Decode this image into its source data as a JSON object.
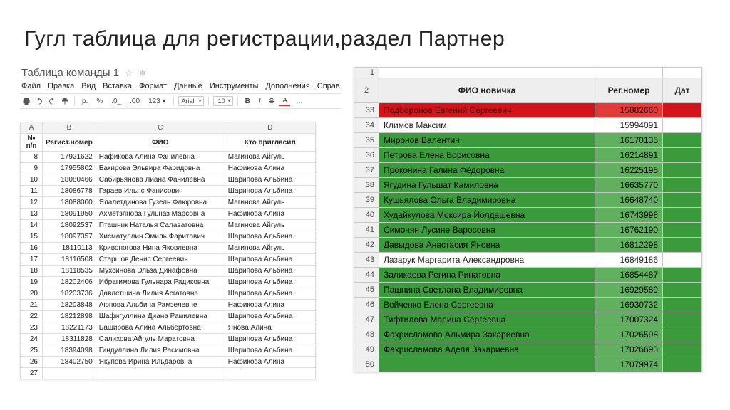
{
  "slide": {
    "title": "Гугл таблица для регистрации,раздел Партнер"
  },
  "left": {
    "sheet_name": "Таблица команды 1",
    "menu": [
      "Файл",
      "Правка",
      "Вид",
      "Вставка",
      "Формат",
      "Данные",
      "Инструменты",
      "Дополнения",
      "Справ"
    ],
    "toolbar": {
      "currency": "р.",
      "percent": "%",
      "dec0": ".0_",
      "dec00": ".00",
      "numfmt": "123 ▾",
      "font": "Arial",
      "size": "10"
    },
    "headers": [
      "№ п/п",
      "Регист.номер",
      "ФИО",
      "Кто пригласил"
    ],
    "rows": [
      {
        "n": 8,
        "reg": 17921622,
        "fio": "Нафикова Алина Фанилевна",
        "inv": "Магинова Айгуль"
      },
      {
        "n": 9,
        "reg": 17955802,
        "fio": "Бакирова Эльвира Фаридовна",
        "inv": "Нафикова Алина"
      },
      {
        "n": 10,
        "reg": 18080466,
        "fio": "Сабирьянова Лиана Фанилевна",
        "inv": "Шарипова Альбина"
      },
      {
        "n": 11,
        "reg": 18086778,
        "fio": "Гараев Ильяс Фанисович",
        "inv": "Шарипова Альбина"
      },
      {
        "n": 12,
        "reg": 18088000,
        "fio": "Ялалетдинова Гузель Флюровна",
        "inv": "Магинова Айгуль"
      },
      {
        "n": 13,
        "reg": 18091950,
        "fio": "Ахметзянова Гульназ Марсовна",
        "inv": "Нафикова Алина"
      },
      {
        "n": 14,
        "reg": 18092537,
        "fio": "Пташник Наталья Салаватовна",
        "inv": "Магинова Айгуль"
      },
      {
        "n": 15,
        "reg": 18097357,
        "fio": "Хисматуллин Эмиль Фаритович",
        "inv": "Шарипова Альбина"
      },
      {
        "n": 16,
        "reg": 18110113,
        "fio": "Кривоногова Нина Яковлевна",
        "inv": "Магинова Айгуль"
      },
      {
        "n": 17,
        "reg": 18116508,
        "fio": "Старшов Денис Сергеевич",
        "inv": "Шарипова Альбина"
      },
      {
        "n": 18,
        "reg": 18118535,
        "fio": "Мухсинова Эльза Динафовна",
        "inv": "Шарипова Альбина"
      },
      {
        "n": 19,
        "reg": 18202406,
        "fio": "Ибрагимова Гульнара Радиковна",
        "inv": "Шарипова Альбина"
      },
      {
        "n": 20,
        "reg": 18203736,
        "fio": "Давлетшина Лилия Асгатовна",
        "inv": "Шарипова Альбина"
      },
      {
        "n": 21,
        "reg": 18203848,
        "fio": "Аюпова Альбина Рамзелевне",
        "inv": "Нафикова Алина"
      },
      {
        "n": 22,
        "reg": 18212898,
        "fio": "Шафигуллина Диана Рамилевна",
        "inv": "Шарипова Альбина"
      },
      {
        "n": 23,
        "reg": 18221173,
        "fio": "Баширова Алина Альбертовна",
        "inv": "Янова Алина"
      },
      {
        "n": 24,
        "reg": 18311828,
        "fio": "Салихова Айгуль Маратовна",
        "inv": "Шарипова Альбина"
      },
      {
        "n": 25,
        "reg": 18394098,
        "fio": "Гиндуллина Лилия Расимовна",
        "inv": "Шарипова Альбина"
      },
      {
        "n": 26,
        "reg": 18402750,
        "fio": "Якупова Ирина Ильдаровна",
        "inv": "Нафикова Алина"
      },
      {
        "n": 27,
        "reg": "",
        "fio": "",
        "inv": ""
      }
    ]
  },
  "right": {
    "headers": [
      "ФИО новичка",
      "Рег.номер",
      "Дат"
    ],
    "rows": [
      {
        "rn": 33,
        "name": "Подборонов Евгений Сергеевич",
        "reg": 15882660,
        "cls": "red"
      },
      {
        "rn": 34,
        "name": "Климов Максим",
        "reg": 15994091,
        "cls": "white"
      },
      {
        "rn": 35,
        "name": "Миронов Валентин",
        "reg": 16170135,
        "cls": "green"
      },
      {
        "rn": 36,
        "name": "Петрова Елена Борисовна",
        "reg": 16214891,
        "cls": "green"
      },
      {
        "rn": 37,
        "name": "Проконина Галина Фёдоровна",
        "reg": 16225195,
        "cls": "green"
      },
      {
        "rn": 38,
        "name": "Ягудина Гульшат Камиловна",
        "reg": 16635770,
        "cls": "green"
      },
      {
        "rn": 39,
        "name": "Кушьялова Ольга Владимировна",
        "reg": 16648740,
        "cls": "green"
      },
      {
        "rn": 40,
        "name": "Худайкулова Моксира Йолдашевна",
        "reg": 16743998,
        "cls": "green"
      },
      {
        "rn": 41,
        "name": "Симонян Лусине Варосовна",
        "reg": 16762190,
        "cls": "green"
      },
      {
        "rn": 42,
        "name": "Давыдова Анастасия Яновна",
        "reg": 16812298,
        "cls": "green"
      },
      {
        "rn": 43,
        "name": "Лазарук Маргарита Александровна",
        "reg": 16849186,
        "cls": "white"
      },
      {
        "rn": 44,
        "name": "Заликаева Регина Ринатовна",
        "reg": 16854487,
        "cls": "green"
      },
      {
        "rn": 45,
        "name": "Пашнина Светлана Владимировна",
        "reg": 16929589,
        "cls": "green"
      },
      {
        "rn": 46,
        "name": "Войченко Елена Сергеевна",
        "reg": 16930732,
        "cls": "green"
      },
      {
        "rn": 47,
        "name": "Тифтилова Марина Сергеевна",
        "reg": 17007324,
        "cls": "green"
      },
      {
        "rn": 48,
        "name": "Фахрисламова Альмира  Закариевна",
        "reg": 17026598,
        "cls": "green"
      },
      {
        "rn": 49,
        "name": "Фахрисламова Аделя Закариевна",
        "reg": 17026693,
        "cls": "green"
      },
      {
        "rn": 50,
        "name": "",
        "reg": 17079974,
        "cls": "green",
        "hair": true
      }
    ]
  }
}
